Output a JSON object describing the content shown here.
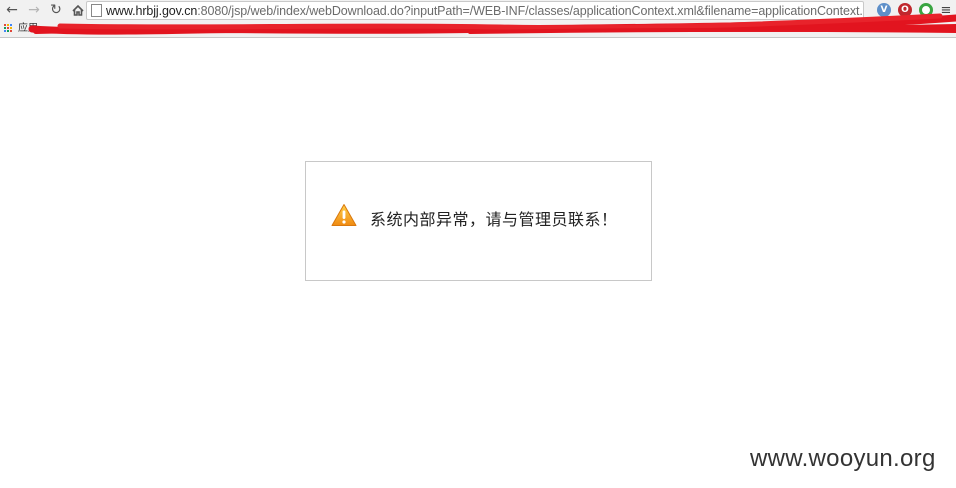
{
  "browser": {
    "url_host": "www.hrbjj.gov.cn",
    "url_rest": ":8080/jsp/web/index/webDownload.do?inputPath=/WEB-INF/classes/applicationContext.xml&filename=applicationContext.",
    "apps_label": "应用"
  },
  "page": {
    "error_message": "系统内部异常，请与管理员联系！"
  },
  "watermark": "www.wooyun.org",
  "colors": {
    "redaction": "#e2141f",
    "warning": "#f3a51c",
    "box_border": "#c8c8c8"
  }
}
